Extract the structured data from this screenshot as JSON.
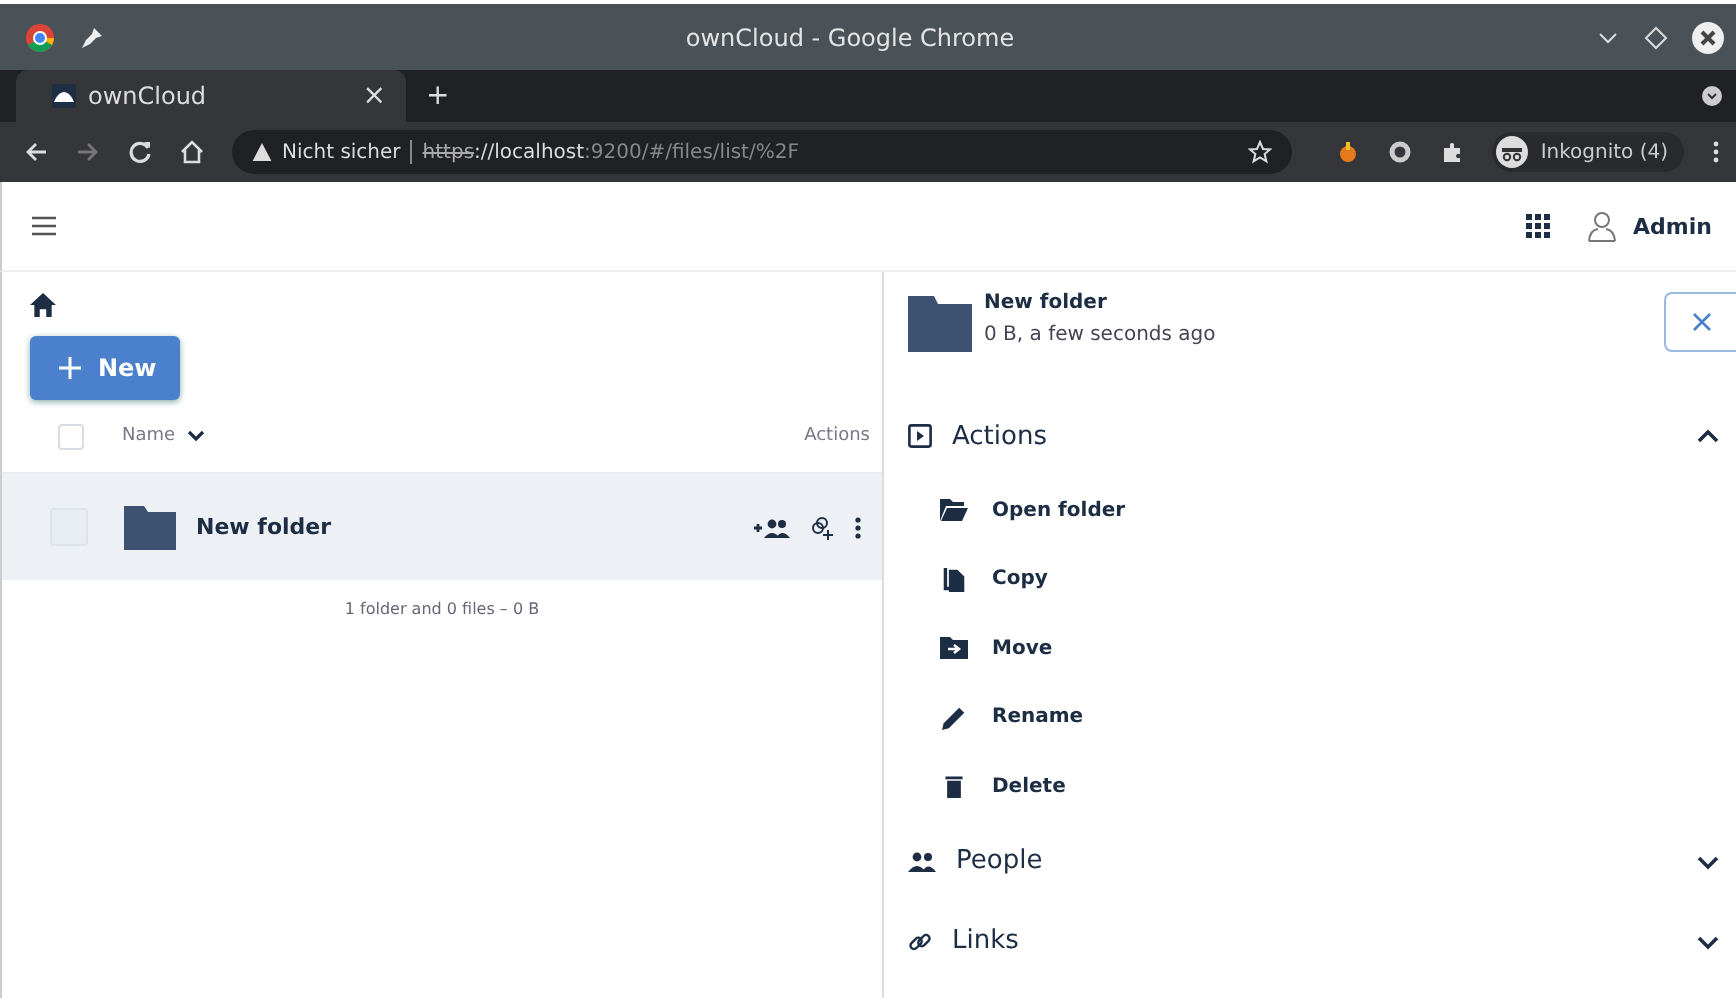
{
  "window": {
    "title": "ownCloud - Google Chrome"
  },
  "browser": {
    "tab": {
      "title": "ownCloud",
      "close": "×"
    },
    "new_tab": "+",
    "url_warning": "Nicht sicher",
    "url_scheme": "https",
    "url_host": "://localhost",
    "url_rest": ":9200/#/files/list/%2F",
    "profile": "Inkognito (4)"
  },
  "header": {
    "user": "Admin"
  },
  "files": {
    "new_button": "New",
    "columns": [
      {
        "label": "Name"
      },
      {
        "label": "Actions"
      }
    ],
    "select_all": {
      "checked": false
    },
    "rows": [
      {
        "name": "New folder",
        "selected": true,
        "checked": false
      }
    ],
    "footer": "1 folder and 0 files – 0 B"
  },
  "details": {
    "name": "New folder",
    "meta": "0 B, a few seconds ago",
    "sections": [
      {
        "kind": "actions",
        "label": "Actions",
        "expanded": true,
        "items": [
          {
            "kind": "open",
            "label": "Open folder"
          },
          {
            "kind": "copy",
            "label": "Copy"
          },
          {
            "kind": "move",
            "label": "Move"
          },
          {
            "kind": "rename",
            "label": "Rename"
          },
          {
            "kind": "delete",
            "label": "Delete"
          }
        ]
      },
      {
        "kind": "people",
        "label": "People",
        "expanded": false
      },
      {
        "kind": "links",
        "label": "Links",
        "expanded": false
      }
    ]
  }
}
